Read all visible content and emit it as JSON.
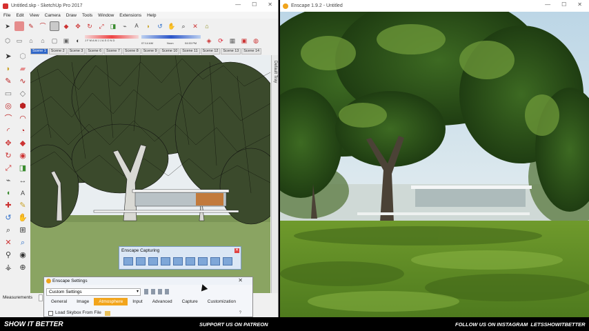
{
  "sketchup": {
    "title": "Untitled.skp - SketchUp Pro 2017",
    "menu": [
      "File",
      "Edit",
      "View",
      "Camera",
      "Draw",
      "Tools",
      "Window",
      "Extensions",
      "Help"
    ],
    "scene_tabs": [
      "Scene 1",
      "Scene 2",
      "Scene 3",
      "Scene 6",
      "Scene 7",
      "Scene 8",
      "Scene 9",
      "Scene 10",
      "Scene 11",
      "Scene 12",
      "Scene 13",
      "Scene 14"
    ],
    "active_scene": "Scene 1",
    "default_tray": "Default Tray",
    "measurements_label": "Measurements",
    "shadow_months": "J F M A M J J A S O N D",
    "shadow_time_start": "07:14 AM",
    "shadow_time_mid": "Noon",
    "shadow_time_end": "04:53 PM"
  },
  "capturing": {
    "title": "Enscape Capturing"
  },
  "settings": {
    "title": "Enscape Settings",
    "preset": "Custom Settings",
    "tabs": [
      "General",
      "Image",
      "Atmosphere",
      "Input",
      "Advanced",
      "Capture",
      "Customization"
    ],
    "active_tab": "Atmosphere",
    "load_skybox_label": "Load Skybox From File"
  },
  "enscape": {
    "title": "Enscape 1.9.2 - Untitled"
  },
  "overlay": {
    "left": "SHOW IT BETTER",
    "center": "SUPPORT US ON PATREON",
    "right": "FOLLOW US ON INSTAGRAM  LETSSHOWITBETTER"
  },
  "colors": {
    "accent_orange": "#f2a51c",
    "scene_tab_blue": "#2f67c9",
    "sky": "#c6dcea",
    "grass": "#6d9a2d"
  }
}
